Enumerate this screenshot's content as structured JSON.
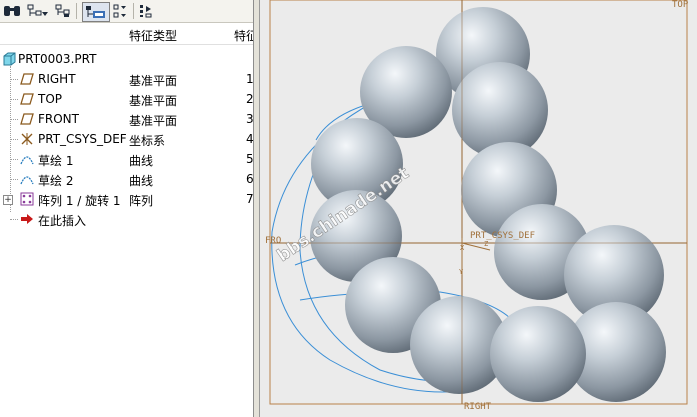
{
  "toolbar": {
    "buttons": [
      {
        "icon": "binoculars-icon",
        "glyph": "👓"
      },
      {
        "icon": "tree-filter-icon",
        "glyph": "▤▾"
      },
      {
        "icon": "layer-tree-icon",
        "glyph": "▤"
      },
      {
        "icon": "model-tree-settings-icon",
        "glyph": "▦"
      },
      {
        "icon": "column-settings-icon",
        "glyph": "▤▾"
      },
      {
        "icon": "tree-columns-icon",
        "glyph": "▤"
      }
    ]
  },
  "columns": {
    "name": "",
    "type": "特征类型",
    "number": "特征"
  },
  "tree": {
    "root": "PRT0003.PRT",
    "items": [
      {
        "label": "RIGHT",
        "type": "基准平面",
        "number": "1",
        "icon": "datum-plane-icon"
      },
      {
        "label": "TOP",
        "type": "基准平面",
        "number": "2",
        "icon": "datum-plane-icon"
      },
      {
        "label": "FRONT",
        "type": "基准平面",
        "number": "3",
        "icon": "datum-plane-icon"
      },
      {
        "label": "PRT_CSYS_DEF",
        "type": "坐标系",
        "number": "4",
        "icon": "coordinate-system-icon"
      },
      {
        "label": "草绘 1",
        "type": "曲线",
        "number": "5",
        "icon": "sketch-icon"
      },
      {
        "label": "草绘 2",
        "type": "曲线",
        "number": "6",
        "icon": "sketch-icon"
      },
      {
        "label": "阵列 1 / 旋转 1",
        "type": "阵列",
        "number": "7",
        "icon": "pattern-icon"
      },
      {
        "label": "在此插入",
        "type": "",
        "number": "",
        "icon": "insert-here-arrow-icon"
      }
    ]
  },
  "viewport": {
    "datum_labels": {
      "top": "TOP",
      "front": "FRO",
      "right": "RIGHT",
      "csys": "PRT_CSYS_DEF",
      "axis_x": "X",
      "axis_y": "Y",
      "axis_z": "Z"
    },
    "watermark": "bbs.chinade.net",
    "colors": {
      "datum": "#a0703a",
      "sketch": "#3b8fd6",
      "sphere": "#a9b3bd",
      "background": "#ebebeb"
    }
  }
}
